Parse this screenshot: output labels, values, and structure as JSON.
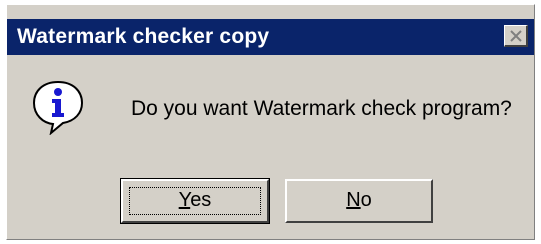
{
  "window": {
    "title": "Watermark checker copy",
    "close_icon": "close-icon"
  },
  "dialog": {
    "icon": "info-icon",
    "message": "Do you want Watermark check program?"
  },
  "buttons": {
    "yes": {
      "mnemonic": "Y",
      "rest": "es"
    },
    "no": {
      "mnemonic": "N",
      "rest": "o"
    }
  },
  "colors": {
    "titlebar": "#0a246a",
    "face": "#d4d0c8",
    "icon_blue": "#1818d0"
  }
}
